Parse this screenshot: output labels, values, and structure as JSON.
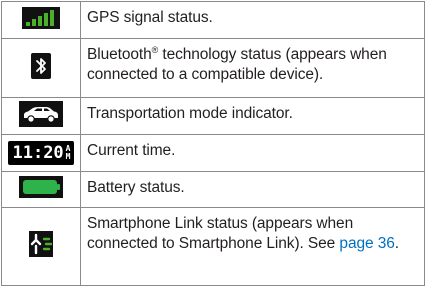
{
  "rows": [
    {
      "icon": "signal-bars-icon",
      "text": "GPS signal status."
    },
    {
      "icon": "bluetooth-icon",
      "text_before": "Bluetooth",
      "registered_mark": "®",
      "text_after": " technology status (appears when connected to a compatible device)."
    },
    {
      "icon": "car-icon",
      "text": "Transportation mode indicator."
    },
    {
      "icon": "clock-time-icon",
      "time_value": "11:20",
      "ampm_top": "A",
      "ampm_bottom": "M",
      "text": "Current time."
    },
    {
      "icon": "battery-icon",
      "text": "Battery status."
    },
    {
      "icon": "smartphone-link-icon",
      "text": "Smartphone Link status (appears when connected to Smartphone Link). See ",
      "link_text": "page 36",
      "text_end": "."
    }
  ],
  "colors": {
    "signal_green": "#4caf2a",
    "battery_green": "#2db34a",
    "link_blue": "#0070c0",
    "border_gray": "#8a8a8a"
  }
}
